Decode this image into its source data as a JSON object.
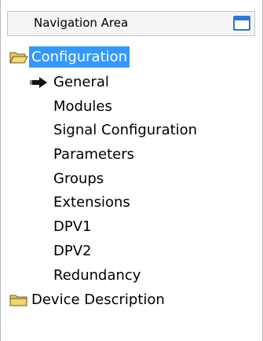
{
  "panel": {
    "title": "Navigation Area",
    "window_icon": "window-restore-icon"
  },
  "tree": {
    "root": {
      "label": "Configuration",
      "icon": "folder-open-icon",
      "selected": true,
      "selection_color": "#3399ff"
    },
    "children": [
      {
        "label": "General",
        "current": true,
        "marker_icon": "arrow-right-icon"
      },
      {
        "label": "Modules"
      },
      {
        "label": "Signal Configuration"
      },
      {
        "label": "Parameters"
      },
      {
        "label": "Groups"
      },
      {
        "label": "Extensions"
      },
      {
        "label": "DPV1"
      },
      {
        "label": "DPV2"
      },
      {
        "label": "Redundancy"
      }
    ],
    "siblings": [
      {
        "label": "Device Description",
        "icon": "folder-closed-icon"
      }
    ]
  }
}
